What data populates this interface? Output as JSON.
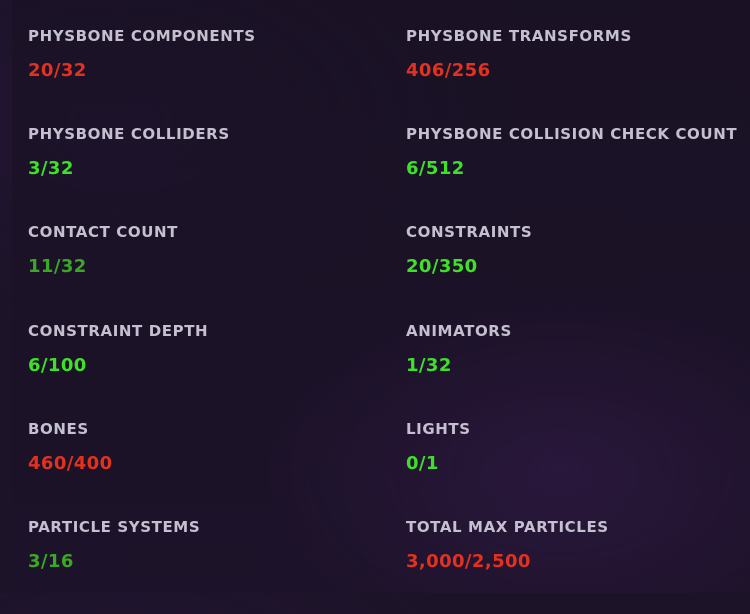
{
  "colors": {
    "over_limit": "#e2321f",
    "ok_bright": "#3ee02a",
    "ok_dim": "#3aa825"
  },
  "stats": [
    {
      "label": "PHYSBONE COMPONENTS",
      "value": "20/32",
      "status": "over_limit"
    },
    {
      "label": "PHYSBONE TRANSFORMS",
      "value": "406/256",
      "status": "over_limit"
    },
    {
      "label": "PHYSBONE COLLIDERS",
      "value": "3/32",
      "status": "ok_bright"
    },
    {
      "label": "PHYSBONE COLLISION CHECK COUNT",
      "value": "6/512",
      "status": "ok_bright"
    },
    {
      "label": "CONTACT COUNT",
      "value": "11/32",
      "status": "ok_dim"
    },
    {
      "label": "CONSTRAINTS",
      "value": "20/350",
      "status": "ok_bright"
    },
    {
      "label": "CONSTRAINT DEPTH",
      "value": "6/100",
      "status": "ok_bright"
    },
    {
      "label": "ANIMATORS",
      "value": "1/32",
      "status": "ok_bright"
    },
    {
      "label": "BONES",
      "value": "460/400",
      "status": "over_limit"
    },
    {
      "label": "LIGHTS",
      "value": "0/1",
      "status": "ok_bright"
    },
    {
      "label": "PARTICLE SYSTEMS",
      "value": "3/16",
      "status": "ok_dim"
    },
    {
      "label": "TOTAL MAX PARTICLES",
      "value": "3,000/2,500",
      "status": "over_limit"
    }
  ]
}
